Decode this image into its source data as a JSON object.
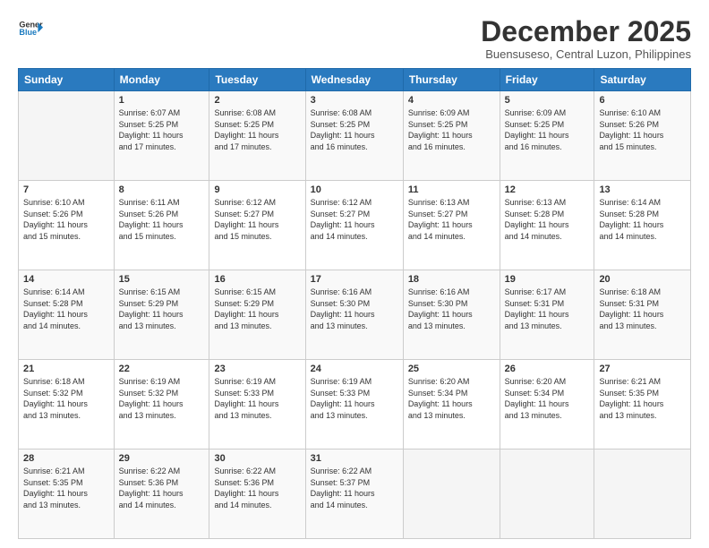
{
  "header": {
    "logo_line1": "General",
    "logo_line2": "Blue",
    "month": "December 2025",
    "location": "Buensuseso, Central Luzon, Philippines"
  },
  "weekdays": [
    "Sunday",
    "Monday",
    "Tuesday",
    "Wednesday",
    "Thursday",
    "Friday",
    "Saturday"
  ],
  "weeks": [
    [
      {
        "day": "",
        "info": ""
      },
      {
        "day": "1",
        "info": "Sunrise: 6:07 AM\nSunset: 5:25 PM\nDaylight: 11 hours\nand 17 minutes."
      },
      {
        "day": "2",
        "info": "Sunrise: 6:08 AM\nSunset: 5:25 PM\nDaylight: 11 hours\nand 17 minutes."
      },
      {
        "day": "3",
        "info": "Sunrise: 6:08 AM\nSunset: 5:25 PM\nDaylight: 11 hours\nand 16 minutes."
      },
      {
        "day": "4",
        "info": "Sunrise: 6:09 AM\nSunset: 5:25 PM\nDaylight: 11 hours\nand 16 minutes."
      },
      {
        "day": "5",
        "info": "Sunrise: 6:09 AM\nSunset: 5:25 PM\nDaylight: 11 hours\nand 16 minutes."
      },
      {
        "day": "6",
        "info": "Sunrise: 6:10 AM\nSunset: 5:26 PM\nDaylight: 11 hours\nand 15 minutes."
      }
    ],
    [
      {
        "day": "7",
        "info": "Sunrise: 6:10 AM\nSunset: 5:26 PM\nDaylight: 11 hours\nand 15 minutes."
      },
      {
        "day": "8",
        "info": "Sunrise: 6:11 AM\nSunset: 5:26 PM\nDaylight: 11 hours\nand 15 minutes."
      },
      {
        "day": "9",
        "info": "Sunrise: 6:12 AM\nSunset: 5:27 PM\nDaylight: 11 hours\nand 15 minutes."
      },
      {
        "day": "10",
        "info": "Sunrise: 6:12 AM\nSunset: 5:27 PM\nDaylight: 11 hours\nand 14 minutes."
      },
      {
        "day": "11",
        "info": "Sunrise: 6:13 AM\nSunset: 5:27 PM\nDaylight: 11 hours\nand 14 minutes."
      },
      {
        "day": "12",
        "info": "Sunrise: 6:13 AM\nSunset: 5:28 PM\nDaylight: 11 hours\nand 14 minutes."
      },
      {
        "day": "13",
        "info": "Sunrise: 6:14 AM\nSunset: 5:28 PM\nDaylight: 11 hours\nand 14 minutes."
      }
    ],
    [
      {
        "day": "14",
        "info": "Sunrise: 6:14 AM\nSunset: 5:28 PM\nDaylight: 11 hours\nand 14 minutes."
      },
      {
        "day": "15",
        "info": "Sunrise: 6:15 AM\nSunset: 5:29 PM\nDaylight: 11 hours\nand 13 minutes."
      },
      {
        "day": "16",
        "info": "Sunrise: 6:15 AM\nSunset: 5:29 PM\nDaylight: 11 hours\nand 13 minutes."
      },
      {
        "day": "17",
        "info": "Sunrise: 6:16 AM\nSunset: 5:30 PM\nDaylight: 11 hours\nand 13 minutes."
      },
      {
        "day": "18",
        "info": "Sunrise: 6:16 AM\nSunset: 5:30 PM\nDaylight: 11 hours\nand 13 minutes."
      },
      {
        "day": "19",
        "info": "Sunrise: 6:17 AM\nSunset: 5:31 PM\nDaylight: 11 hours\nand 13 minutes."
      },
      {
        "day": "20",
        "info": "Sunrise: 6:18 AM\nSunset: 5:31 PM\nDaylight: 11 hours\nand 13 minutes."
      }
    ],
    [
      {
        "day": "21",
        "info": "Sunrise: 6:18 AM\nSunset: 5:32 PM\nDaylight: 11 hours\nand 13 minutes."
      },
      {
        "day": "22",
        "info": "Sunrise: 6:19 AM\nSunset: 5:32 PM\nDaylight: 11 hours\nand 13 minutes."
      },
      {
        "day": "23",
        "info": "Sunrise: 6:19 AM\nSunset: 5:33 PM\nDaylight: 11 hours\nand 13 minutes."
      },
      {
        "day": "24",
        "info": "Sunrise: 6:19 AM\nSunset: 5:33 PM\nDaylight: 11 hours\nand 13 minutes."
      },
      {
        "day": "25",
        "info": "Sunrise: 6:20 AM\nSunset: 5:34 PM\nDaylight: 11 hours\nand 13 minutes."
      },
      {
        "day": "26",
        "info": "Sunrise: 6:20 AM\nSunset: 5:34 PM\nDaylight: 11 hours\nand 13 minutes."
      },
      {
        "day": "27",
        "info": "Sunrise: 6:21 AM\nSunset: 5:35 PM\nDaylight: 11 hours\nand 13 minutes."
      }
    ],
    [
      {
        "day": "28",
        "info": "Sunrise: 6:21 AM\nSunset: 5:35 PM\nDaylight: 11 hours\nand 13 minutes."
      },
      {
        "day": "29",
        "info": "Sunrise: 6:22 AM\nSunset: 5:36 PM\nDaylight: 11 hours\nand 14 minutes."
      },
      {
        "day": "30",
        "info": "Sunrise: 6:22 AM\nSunset: 5:36 PM\nDaylight: 11 hours\nand 14 minutes."
      },
      {
        "day": "31",
        "info": "Sunrise: 6:22 AM\nSunset: 5:37 PM\nDaylight: 11 hours\nand 14 minutes."
      },
      {
        "day": "",
        "info": ""
      },
      {
        "day": "",
        "info": ""
      },
      {
        "day": "",
        "info": ""
      }
    ]
  ]
}
